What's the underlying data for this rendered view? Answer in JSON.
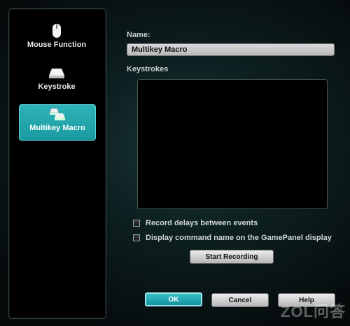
{
  "sidebar": {
    "items": [
      {
        "label": "Mouse Function",
        "icon": "mouse-icon",
        "active": false
      },
      {
        "label": "Keystroke",
        "icon": "key-icon",
        "active": false
      },
      {
        "label": "Multikey Macro",
        "icon": "multikey-icon",
        "active": true
      }
    ]
  },
  "form": {
    "name_label": "Name:",
    "name_value": "Multikey Macro",
    "keystrokes_label": "Keystrokes",
    "record_delays_label": "Record delays between events",
    "record_delays_checked": false,
    "display_command_label": "Display command name on the GamePanel display",
    "display_command_checked": false,
    "start_recording_label": "Start Recording"
  },
  "footer": {
    "ok_label": "OK",
    "cancel_label": "Cancel",
    "help_label": "Help"
  },
  "watermark": "ZOL问答",
  "colors": {
    "accent": "#1fa3a9",
    "background": "#0d1f20"
  }
}
